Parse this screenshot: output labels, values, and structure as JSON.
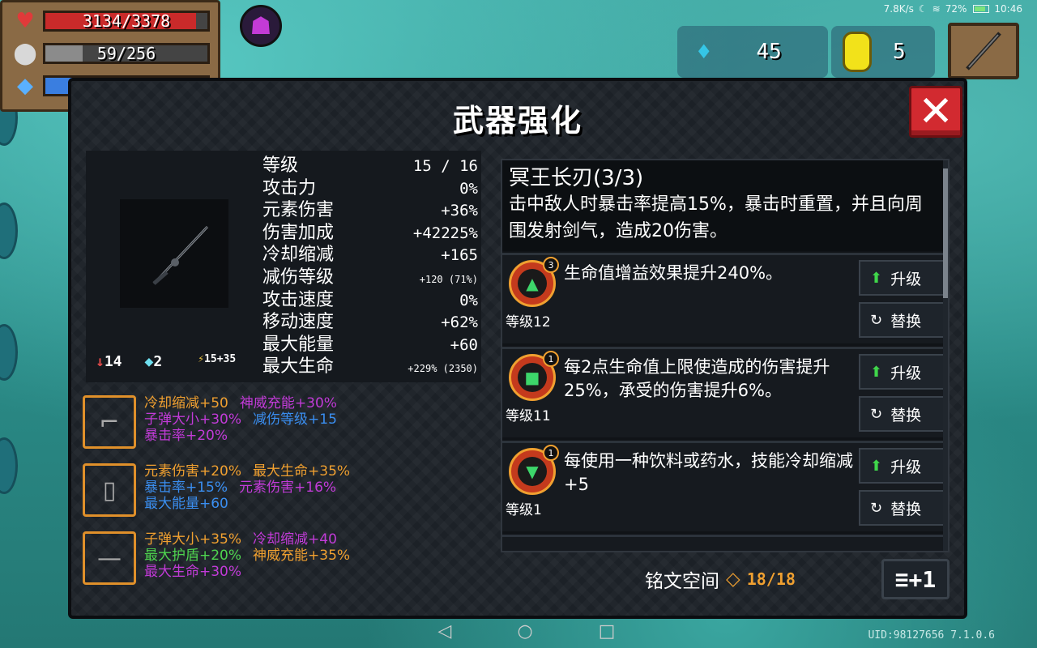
{
  "status_bar": {
    "network": "7.8K/s",
    "battery": "72%",
    "time": "10:46"
  },
  "player": {
    "hp": "3134/3378",
    "armor": "59/256",
    "energy": "",
    "hp_fill": 0.928,
    "armor_fill": 0.23
  },
  "currencies": {
    "gems": "45",
    "coins": "5"
  },
  "dialog": {
    "title": "武器强化",
    "close_label": "✕"
  },
  "weapon": {
    "stats": [
      {
        "label": "等级",
        "value": "15 / 16"
      },
      {
        "label": "攻击力",
        "value": "0%"
      },
      {
        "label": "元素伤害",
        "value": "+36%"
      },
      {
        "label": "伤害加成",
        "value": "+42225%"
      },
      {
        "label": "冷却缩减",
        "value": "+165"
      },
      {
        "label": "减伤等级",
        "value": "+120 (71%)"
      },
      {
        "label": "攻击速度",
        "value": "0%"
      },
      {
        "label": "移动速度",
        "value": "+62%"
      },
      {
        "label": "最大能量",
        "value": "+60"
      },
      {
        "label": "最大生命",
        "value": "+229% (2350)"
      }
    ],
    "footer": {
      "damage": "14",
      "gems": "2",
      "crit": "15+35"
    }
  },
  "inscriptions": [
    {
      "lines": [
        [
          {
            "t": "冷却缩减+50",
            "c": "orange"
          },
          {
            "t": "神威充能+30%",
            "c": "purple"
          }
        ],
        [
          {
            "t": "子弹大小+30%",
            "c": "purple"
          },
          {
            "t": "减伤等级+15",
            "c": "blue"
          }
        ],
        [
          {
            "t": "暴击率+20%",
            "c": "purple"
          }
        ]
      ]
    },
    {
      "lines": [
        [
          {
            "t": "元素伤害+20%",
            "c": "orange"
          },
          {
            "t": "最大生命+35%",
            "c": "orange"
          }
        ],
        [
          {
            "t": "暴击率+15%",
            "c": "blue"
          },
          {
            "t": "元素伤害+16%",
            "c": "purple"
          }
        ],
        [
          {
            "t": "最大能量+60",
            "c": "blue"
          }
        ]
      ]
    },
    {
      "lines": [
        [
          {
            "t": "子弹大小+35%",
            "c": "orange"
          },
          {
            "t": "冷却缩减+40",
            "c": "purple"
          }
        ],
        [
          {
            "t": "最大护盾+20%",
            "c": "green"
          },
          {
            "t": "神威充能+35%",
            "c": "orange"
          }
        ],
        [
          {
            "t": "最大生命+30%",
            "c": "purple"
          }
        ]
      ]
    }
  ],
  "description": {
    "name": "冥王长刃(3/3)",
    "text": "击中敌人时暴击率提高15%，暴击时重置，并且向周围发射剑气，造成20伤害。"
  },
  "perks": [
    {
      "badge": "3",
      "level": "等级12",
      "text": "生命值增益效果提升240%。",
      "upgrade": "升级",
      "replace": "替换"
    },
    {
      "badge": "1",
      "level": "等级11",
      "text": "每2点生命值上限使造成的伤害提升25%，承受的伤害提升6%。",
      "upgrade": "升级",
      "replace": "替换"
    },
    {
      "badge": "1",
      "level": "等级1",
      "text": "每使用一种饮料或药水，技能冷却缩减+5",
      "upgrade": "升级",
      "replace": "替换"
    }
  ],
  "rune_space": {
    "label": "铭文空间",
    "count": "18/18"
  },
  "plus_button": "≡+1",
  "uid": "UID:98127656 7.1.0.6",
  "colors": {
    "orange": "#f0a030",
    "purple": "#c23bd8",
    "blue": "#3a8ef0",
    "green": "#4fd44f"
  }
}
